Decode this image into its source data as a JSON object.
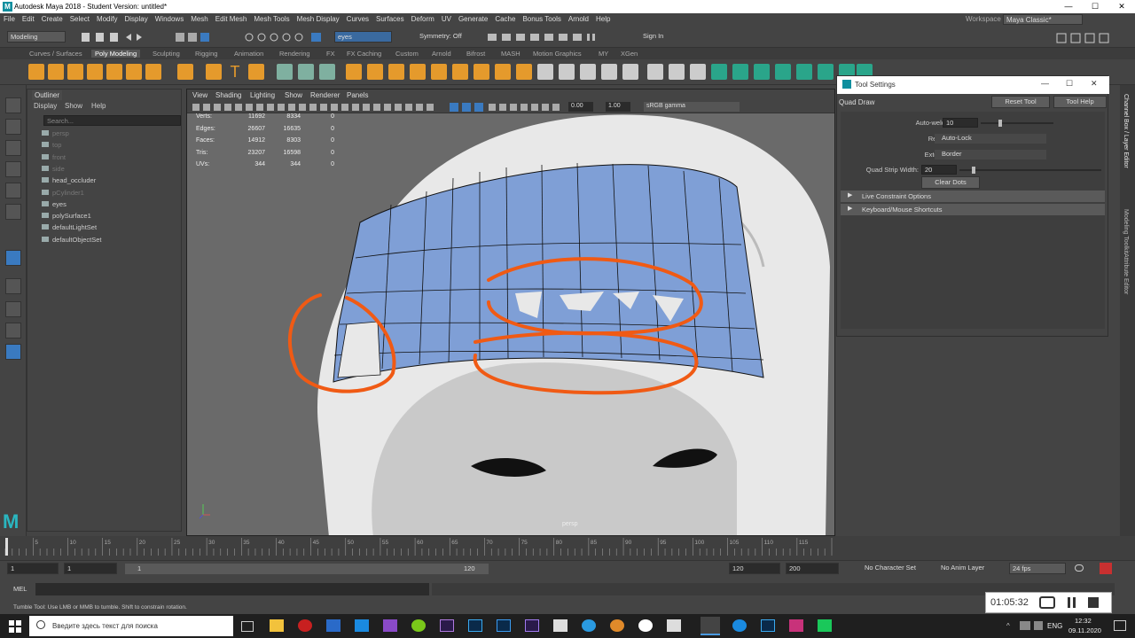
{
  "title": "Autodesk Maya 2018 - Student Version: untitled*",
  "logo_letter": "M",
  "window_controls": [
    "—",
    "☐",
    "✕"
  ],
  "menubar": [
    "File",
    "Edit",
    "Create",
    "Select",
    "Modify",
    "Display",
    "Windows",
    "Mesh",
    "Edit Mesh",
    "Mesh Tools",
    "Mesh Display",
    "Curves",
    "Surfaces",
    "Deform",
    "UV",
    "Generate",
    "Cache",
    "Bonus Tools",
    "Arnold",
    "Help"
  ],
  "workspace_label": "Workspace :",
  "workspace_value": "Maya Classic*",
  "mode_select": "Modeling",
  "selection_field": "eyes",
  "symmetry": "Symmetry: Off",
  "sign_in": "Sign In",
  "shelf_tabs": [
    "Curves / Surfaces",
    "Poly Modeling",
    "Sculpting",
    "Rigging",
    "Animation",
    "Rendering",
    "FX",
    "FX Caching",
    "Custom",
    "Arnold",
    "Bifrost",
    "MASH",
    "Motion Graphics",
    "MY",
    "XGen"
  ],
  "shelf_active": "Poly Modeling",
  "outliner": {
    "title": "Outliner",
    "menu": [
      "Display",
      "Show",
      "Help"
    ],
    "search_placeholder": "Search...",
    "items": [
      {
        "label": "persp",
        "dim": true
      },
      {
        "label": "top",
        "dim": true
      },
      {
        "label": "front",
        "dim": true
      },
      {
        "label": "side",
        "dim": true
      },
      {
        "label": "head_occluder",
        "dim": false
      },
      {
        "label": "pCylinder1",
        "dim": true
      },
      {
        "label": "eyes",
        "dim": false
      },
      {
        "label": "polySurface1",
        "dim": false
      },
      {
        "label": "defaultLightSet",
        "dim": false
      },
      {
        "label": "defaultObjectSet",
        "dim": false
      }
    ]
  },
  "viewport": {
    "menu": [
      "View",
      "Shading",
      "Lighting",
      "Show",
      "Renderer",
      "Panels"
    ],
    "exposure": "0.00",
    "gamma": "1.00",
    "colorspace": "sRGB gamma",
    "camera_label": "persp",
    "hud": [
      {
        "label": "Verts:",
        "a": "11692",
        "b": "8334",
        "c": "0"
      },
      {
        "label": "Edges:",
        "a": "26607",
        "b": "16635",
        "c": "0"
      },
      {
        "label": "Faces:",
        "a": "14912",
        "b": "8303",
        "c": "0"
      },
      {
        "label": "Tris:",
        "a": "23207",
        "b": "16598",
        "c": "0"
      },
      {
        "label": "UVs:",
        "a": "344",
        "b": "344",
        "c": "0"
      }
    ]
  },
  "tool_settings": {
    "window_title": "Tool Settings",
    "tool_name": "Quad Draw",
    "reset_label": "Reset Tool",
    "help_label": "Tool Help",
    "autoweld_label": "Auto-weld:",
    "autoweld_check": "✓",
    "autoweld_value": "10",
    "relax_label": "Relax:",
    "relax_value": "Auto-Lock",
    "extend_label": "Extend:",
    "extend_value": "Border",
    "strip_label": "Quad Strip Width:",
    "strip_value": "20",
    "clear_dots": "Clear Dots",
    "sections": [
      "Live Constraint Options",
      "Keyboard/Mouse Shortcuts"
    ]
  },
  "right_tabs": [
    "Channel Box / Layer Editor",
    "Modeling Toolkit",
    "Attribute Editor"
  ],
  "timeline": {
    "ticks": [
      "5",
      "10",
      "15",
      "20",
      "25",
      "30",
      "35",
      "40",
      "45",
      "50",
      "55",
      "60",
      "65",
      "70",
      "75",
      "80",
      "85",
      "90",
      "95",
      "100",
      "105",
      "110",
      "115"
    ],
    "current": "1"
  },
  "range": {
    "start": "1",
    "start2": "1",
    "slider_start": "1",
    "slider_end": "120",
    "end": "120",
    "end2": "200",
    "character_set": "No Character Set",
    "anim_layer": "No Anim Layer",
    "fps": "24 fps"
  },
  "cmd_label": "MEL",
  "help_line": "Tumble Tool: Use LMB or MMB to tumble. Shift to constrain rotation.",
  "recorder_time": "01:05:32",
  "taskbar": {
    "search_placeholder": "Введите здесь текст для поиска",
    "lang": "ENG",
    "time": "12:32",
    "date": "09.11.2020"
  },
  "colors": {
    "accent": "#4a86c8",
    "mesh_blue": "#7f9fd6",
    "annotation": "#f05a14"
  }
}
